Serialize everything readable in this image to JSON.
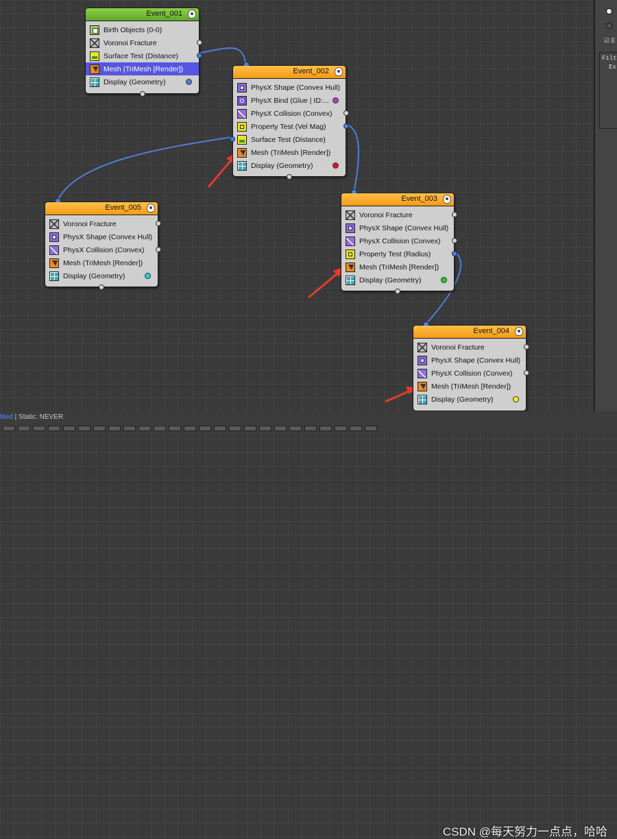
{
  "nodes": [
    {
      "id": "event-001",
      "title": "Event_001",
      "header_color": "green",
      "operators": [
        {
          "label": "Birth Objects (0-0)",
          "icon": "birth-objects-icon",
          "output": "none"
        },
        {
          "label": "Voronoi Fracture",
          "icon": "voronoi-fracture-icon",
          "output": "free"
        },
        {
          "label": "Surface Test (Distance)",
          "icon": "surface-test-icon",
          "output": "linked"
        },
        {
          "label": "Mesh (TriMesh [Render])",
          "icon": "mesh-icon",
          "output": "none",
          "selected": true
        },
        {
          "label": "Display (Geometry)",
          "icon": "display-icon",
          "display_color": "#4f7fd8"
        }
      ]
    },
    {
      "id": "event-002",
      "title": "Event_002",
      "header_color": "orange",
      "operators": [
        {
          "label": "PhysX Shape (Convex Hull)",
          "icon": "physx-shape-icon",
          "output": "none"
        },
        {
          "label": "PhysX Bind (Glue | ID:...",
          "icon": "physx-bind-icon",
          "output": "none",
          "display_color": "#b040b8"
        },
        {
          "label": "PhysX Collision (Convex)",
          "icon": "physx-collision-icon",
          "output": "free"
        },
        {
          "label": "Property Test (Vel Mag)",
          "icon": "property-test-icon",
          "output": "linked"
        },
        {
          "label": "Surface Test (Distance)",
          "icon": "surface-test-icon",
          "output": "none"
        },
        {
          "label": "Mesh (TriMesh [Render])",
          "icon": "mesh-icon",
          "output": "none"
        },
        {
          "label": "Display (Geometry)",
          "icon": "display-icon",
          "display_color": "#e01818"
        }
      ]
    },
    {
      "id": "event-005",
      "title": "Event_005",
      "header_color": "orange",
      "operators": [
        {
          "label": "Voronoi Fracture",
          "icon": "voronoi-fracture-icon",
          "output": "free"
        },
        {
          "label": "PhysX Shape (Convex Hull)",
          "icon": "physx-shape-icon",
          "output": "none"
        },
        {
          "label": "PhysX Collision (Convex)",
          "icon": "physx-collision-icon",
          "output": "free"
        },
        {
          "label": "Mesh (TriMesh [Render])",
          "icon": "mesh-icon",
          "output": "none"
        },
        {
          "label": "Display (Geometry)",
          "icon": "display-icon",
          "display_color": "#18d8e0"
        }
      ]
    },
    {
      "id": "event-003",
      "title": "Event_003",
      "header_color": "orange",
      "operators": [
        {
          "label": "Voronoi Fracture",
          "icon": "voronoi-fracture-icon",
          "output": "free"
        },
        {
          "label": "PhysX Shape (Convex Hull)",
          "icon": "physx-shape-icon",
          "output": "none"
        },
        {
          "label": "PhysX Collision (Convex)",
          "icon": "physx-collision-icon",
          "output": "free"
        },
        {
          "label": "Property Test (Radius)",
          "icon": "property-test-icon",
          "output": "linked"
        },
        {
          "label": "Mesh (TriMesh [Render])",
          "icon": "mesh-icon",
          "output": "none"
        },
        {
          "label": "Display (Geometry)",
          "icon": "display-icon",
          "display_color": "#22d022"
        }
      ]
    },
    {
      "id": "event-004",
      "title": "Event_004",
      "header_color": "orange",
      "operators": [
        {
          "label": "Voronoi Fracture",
          "icon": "voronoi-fracture-icon",
          "output": "free"
        },
        {
          "label": "PhysX Shape (Convex Hull)",
          "icon": "physx-shape-icon",
          "output": "none"
        },
        {
          "label": "PhysX Collision (Convex)",
          "icon": "physx-collision-icon",
          "output": "free"
        },
        {
          "label": "Mesh (TriMesh [Render])",
          "icon": "mesh-icon",
          "output": "none"
        },
        {
          "label": "Display (Geometry)",
          "icon": "display-icon",
          "display_color": "#f0f018"
        }
      ]
    }
  ],
  "panel": {
    "check_label": "E",
    "filter_label": "Filt",
    "ex_label": "Ex"
  },
  "status": {
    "prefix": "bled",
    "text": " | Static: NEVER"
  },
  "watermark": "CSDN @每天努力一点点，哈哈",
  "colors": {
    "wire": "#4f7fd8",
    "arrow": "#e83a2a",
    "header_orange": "#f5a623",
    "header_green": "#6cbf3a",
    "selected_row": "#5656e0"
  }
}
